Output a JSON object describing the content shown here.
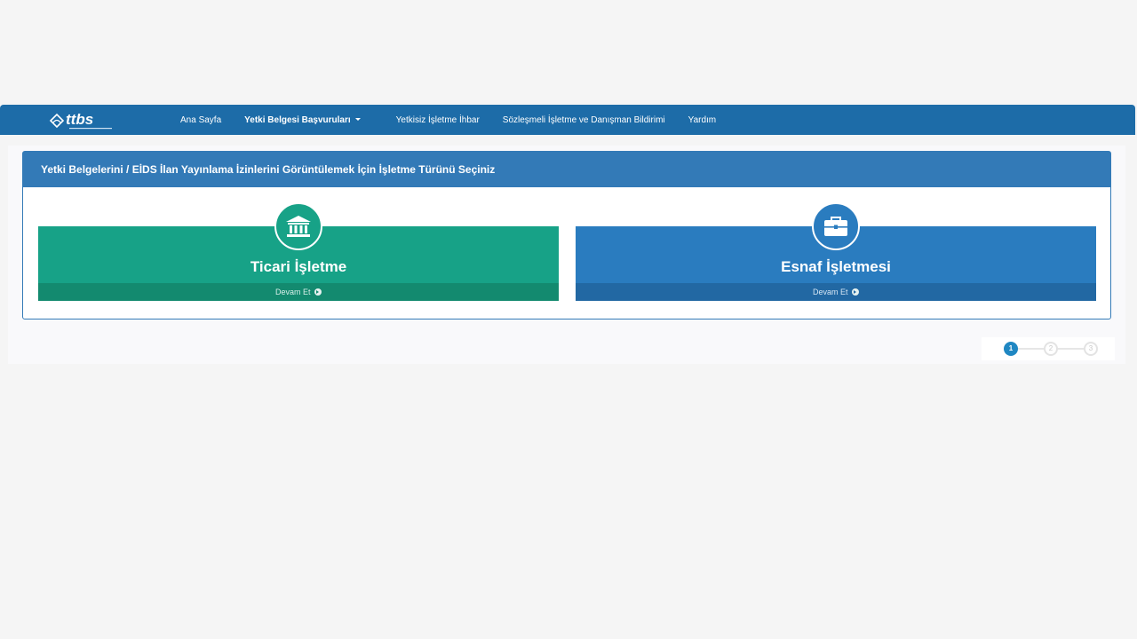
{
  "nav": {
    "logo_text": "ttbs",
    "items": [
      {
        "label": "Ana Sayfa"
      },
      {
        "label": "Yetki Belgesi Başvuruları"
      },
      {
        "label": "Yetkisiz İşletme İhbar"
      },
      {
        "label": "Sözleşmeli İşletme ve Danışman Bildirimi"
      },
      {
        "label": "Yardım"
      }
    ]
  },
  "panel": {
    "heading": "Yetki Belgelerini / EİDS İlan Yayınlama İzinlerini Görüntülemek İçin İşletme Türünü Seçiniz"
  },
  "cards": [
    {
      "title": "Ticari İşletme",
      "footer": "Devam Et",
      "icon": "bank-icon",
      "color": "#17a287"
    },
    {
      "title": "Esnaf İşletmesi",
      "footer": "Devam Et",
      "icon": "briefcase-icon",
      "color": "#2a7cbf"
    }
  ],
  "stepper": {
    "steps": [
      "1",
      "2",
      "3"
    ],
    "active_step": 1
  }
}
